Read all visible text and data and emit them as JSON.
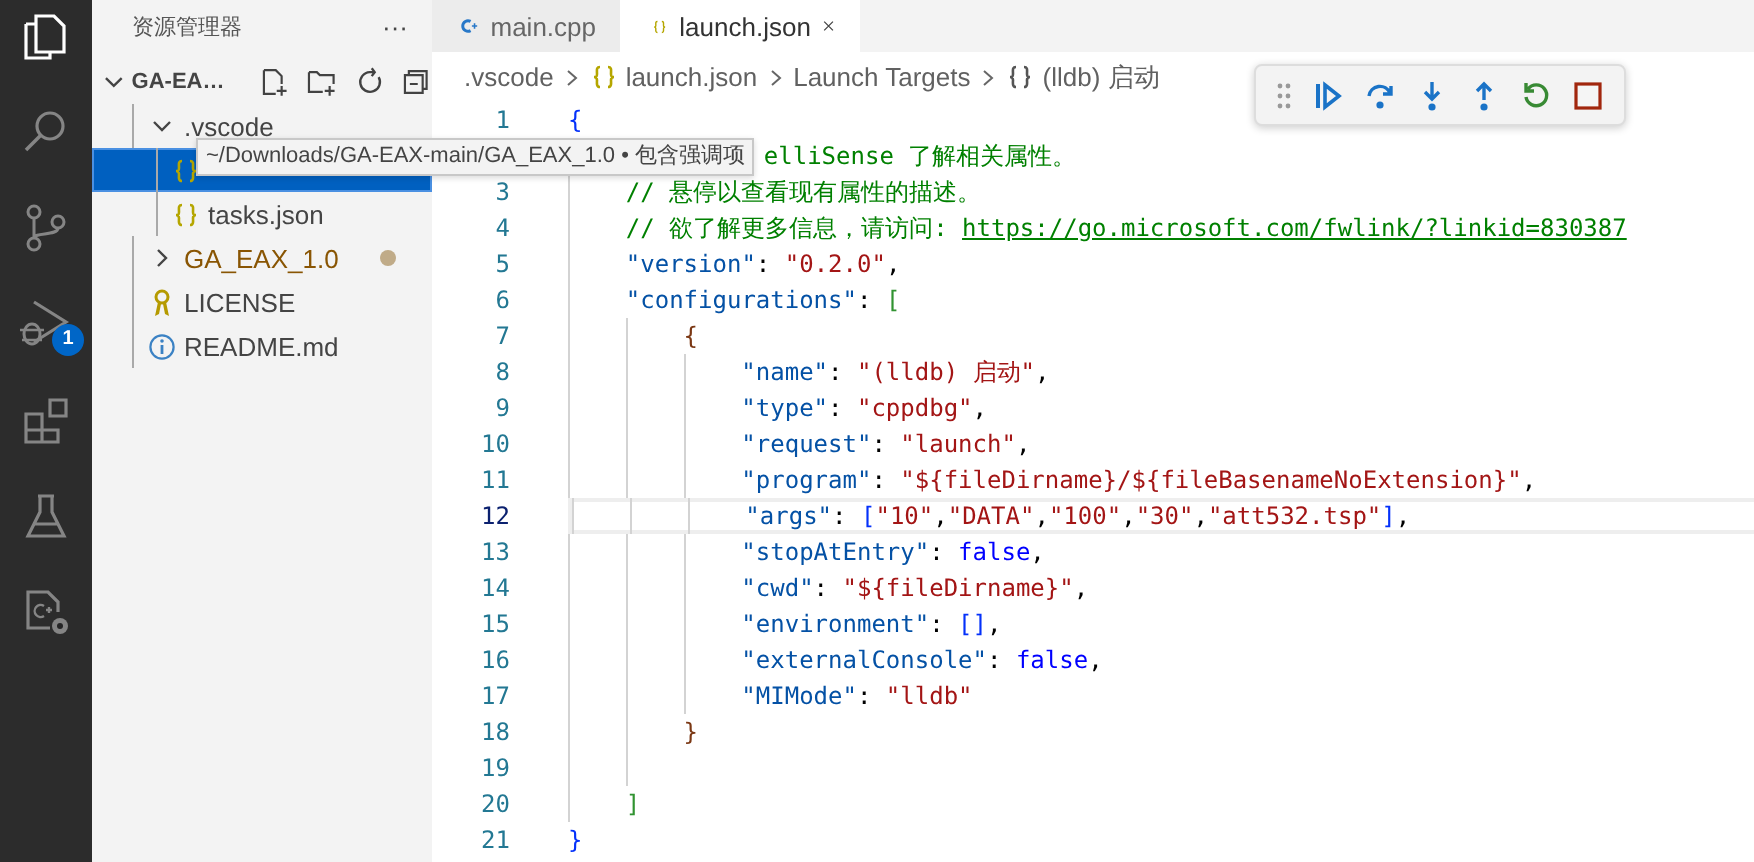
{
  "activity_bar": {
    "items": [
      {
        "kind": "files",
        "selected": true
      },
      {
        "kind": "search",
        "selected": false
      },
      {
        "kind": "source-control",
        "selected": false
      },
      {
        "kind": "debug",
        "selected": false,
        "badge": "1"
      },
      {
        "kind": "extensions",
        "selected": false
      },
      {
        "kind": "testing",
        "selected": false
      },
      {
        "kind": "cpp-config",
        "selected": false
      }
    ]
  },
  "sidebar": {
    "title": "资源管理器",
    "more": "···",
    "folder": {
      "label": "GA-EA…",
      "expanded": true
    },
    "tree": [
      {
        "label": ".vscode",
        "kind": "folder",
        "expanded": true,
        "selected": false,
        "modified": false,
        "children": [
          {
            "kind": "json",
            "selected": true,
            "modified": false
          },
          {
            "label": "tasks.json",
            "kind": "json",
            "selected": false,
            "modified": false
          }
        ]
      },
      {
        "label": "GA_EAX_1.0",
        "kind": "folder",
        "expanded": false,
        "selected": false,
        "modified": true
      },
      {
        "label": "LICENSE",
        "kind": "license",
        "selected": false,
        "modified": false
      },
      {
        "label": "README.md",
        "kind": "info",
        "selected": false,
        "modified": false
      }
    ],
    "tooltip": "~/Downloads/GA-EAX-main/GA_EAX_1.0 • 包含强调项"
  },
  "tabs": [
    {
      "label": "main.cpp",
      "kind": "cpp",
      "selected": false
    },
    {
      "label": "launch.json",
      "kind": "json",
      "selected": true
    }
  ],
  "breadcrumb": [
    {
      "label": ".vscode",
      "kind": "folder"
    },
    {
      "label": "launch.json",
      "kind": "json"
    },
    {
      "label": "Launch Targets",
      "kind": "section"
    },
    {
      "label": "(lldb) 启动",
      "kind": "object"
    }
  ],
  "debug_toolbar": {
    "buttons": [
      {
        "kind": "continue"
      },
      {
        "kind": "step-over"
      },
      {
        "kind": "step-into"
      },
      {
        "kind": "step-out"
      },
      {
        "kind": "restart"
      },
      {
        "kind": "stop"
      }
    ]
  },
  "editor": {
    "lines": [
      {
        "number": "1",
        "current": false,
        "tokens": [
          {
            "kind": "bracket1",
            "text": "{"
          }
        ]
      },
      {
        "current": false,
        "covered": true,
        "tokens": [
          {
            "kind": "comment",
            "text": "    elliSense 了解相关属性。"
          }
        ]
      },
      {
        "number": "3",
        "current": false,
        "tokens": [
          {
            "kind": "comment",
            "text": "    // 悬停以查看现有属性的描述。"
          }
        ]
      },
      {
        "number": "4",
        "current": false,
        "tokens": [
          {
            "kind": "comment",
            "text": "    // 欲了解更多信息，请访问: "
          },
          {
            "kind": "link",
            "text": "https://go.microsoft.com/fwlink/?linkid=830387"
          }
        ]
      },
      {
        "number": "5",
        "current": false,
        "tokens": [
          {
            "kind": "key",
            "text": "    \"version\""
          },
          {
            "kind": "punct",
            "text": ": "
          },
          {
            "kind": "string",
            "text": "\"0.2.0\""
          },
          {
            "kind": "punct",
            "text": ","
          }
        ]
      },
      {
        "number": "6",
        "current": false,
        "tokens": [
          {
            "kind": "key",
            "text": "    \"configurations\""
          },
          {
            "kind": "punct",
            "text": ": "
          },
          {
            "kind": "bracket2",
            "text": "["
          }
        ]
      },
      {
        "number": "7",
        "current": false,
        "tokens": [
          {
            "kind": "bracket3",
            "text": "        {"
          }
        ]
      },
      {
        "number": "8",
        "current": false,
        "tokens": [
          {
            "kind": "key",
            "text": "            \"name\""
          },
          {
            "kind": "punct",
            "text": ": "
          },
          {
            "kind": "string",
            "text": "\"(lldb) 启动\""
          },
          {
            "kind": "punct",
            "text": ","
          }
        ]
      },
      {
        "number": "9",
        "current": false,
        "tokens": [
          {
            "kind": "key",
            "text": "            \"type\""
          },
          {
            "kind": "punct",
            "text": ": "
          },
          {
            "kind": "string",
            "text": "\"cppdbg\""
          },
          {
            "kind": "punct",
            "text": ","
          }
        ]
      },
      {
        "number": "10",
        "current": false,
        "tokens": [
          {
            "kind": "key",
            "text": "            \"request\""
          },
          {
            "kind": "punct",
            "text": ": "
          },
          {
            "kind": "string",
            "text": "\"launch\""
          },
          {
            "kind": "punct",
            "text": ","
          }
        ]
      },
      {
        "number": "11",
        "current": false,
        "tokens": [
          {
            "kind": "key",
            "text": "            \"program\""
          },
          {
            "kind": "punct",
            "text": ": "
          },
          {
            "kind": "string",
            "text": "\"${fileDirname}/${fileBasenameNoExtension}\""
          },
          {
            "kind": "punct",
            "text": ","
          }
        ]
      },
      {
        "number": "12",
        "current": true,
        "tokens": [
          {
            "kind": "key",
            "text": "            \"args\""
          },
          {
            "kind": "punct",
            "text": ": "
          },
          {
            "kind": "bracket1",
            "text": "["
          },
          {
            "kind": "string",
            "text": "\"10\""
          },
          {
            "kind": "punct",
            "text": ","
          },
          {
            "kind": "string",
            "text": "\"DATA\""
          },
          {
            "kind": "punct",
            "text": ","
          },
          {
            "kind": "string",
            "text": "\"100\""
          },
          {
            "kind": "punct",
            "text": ","
          },
          {
            "kind": "string",
            "text": "\"30\""
          },
          {
            "kind": "punct",
            "text": ","
          },
          {
            "kind": "string",
            "text": "\"att532.tsp\""
          },
          {
            "kind": "bracket1",
            "text": "]"
          },
          {
            "kind": "punct",
            "text": ","
          }
        ]
      },
      {
        "number": "13",
        "current": false,
        "tokens": [
          {
            "kind": "key",
            "text": "            \"stopAtEntry\""
          },
          {
            "kind": "punct",
            "text": ": "
          },
          {
            "kind": "keyword",
            "text": "false"
          },
          {
            "kind": "punct",
            "text": ","
          }
        ]
      },
      {
        "number": "14",
        "current": false,
        "tokens": [
          {
            "kind": "key",
            "text": "            \"cwd\""
          },
          {
            "kind": "punct",
            "text": ": "
          },
          {
            "kind": "string",
            "text": "\"${fileDirname}\""
          },
          {
            "kind": "punct",
            "text": ","
          }
        ]
      },
      {
        "number": "15",
        "current": false,
        "tokens": [
          {
            "kind": "key",
            "text": "            \"environment\""
          },
          {
            "kind": "punct",
            "text": ": "
          },
          {
            "kind": "bracket1",
            "text": "[]"
          },
          {
            "kind": "punct",
            "text": ","
          }
        ]
      },
      {
        "number": "16",
        "current": false,
        "tokens": [
          {
            "kind": "key",
            "text": "            \"externalConsole\""
          },
          {
            "kind": "punct",
            "text": ": "
          },
          {
            "kind": "keyword",
            "text": "false"
          },
          {
            "kind": "punct",
            "text": ","
          }
        ]
      },
      {
        "number": "17",
        "current": false,
        "tokens": [
          {
            "kind": "key",
            "text": "            \"MIMode\""
          },
          {
            "kind": "punct",
            "text": ": "
          },
          {
            "kind": "string",
            "text": "\"lldb\""
          }
        ]
      },
      {
        "number": "18",
        "current": false,
        "tokens": [
          {
            "kind": "bracket3",
            "text": "        }"
          }
        ]
      },
      {
        "number": "19",
        "current": false
      },
      {
        "number": "20",
        "current": false,
        "tokens": [
          {
            "kind": "bracket2",
            "text": "    ]"
          }
        ]
      },
      {
        "number": "21",
        "current": false,
        "tokens": [
          {
            "kind": "bracket1",
            "text": "}"
          }
        ]
      }
    ]
  }
}
